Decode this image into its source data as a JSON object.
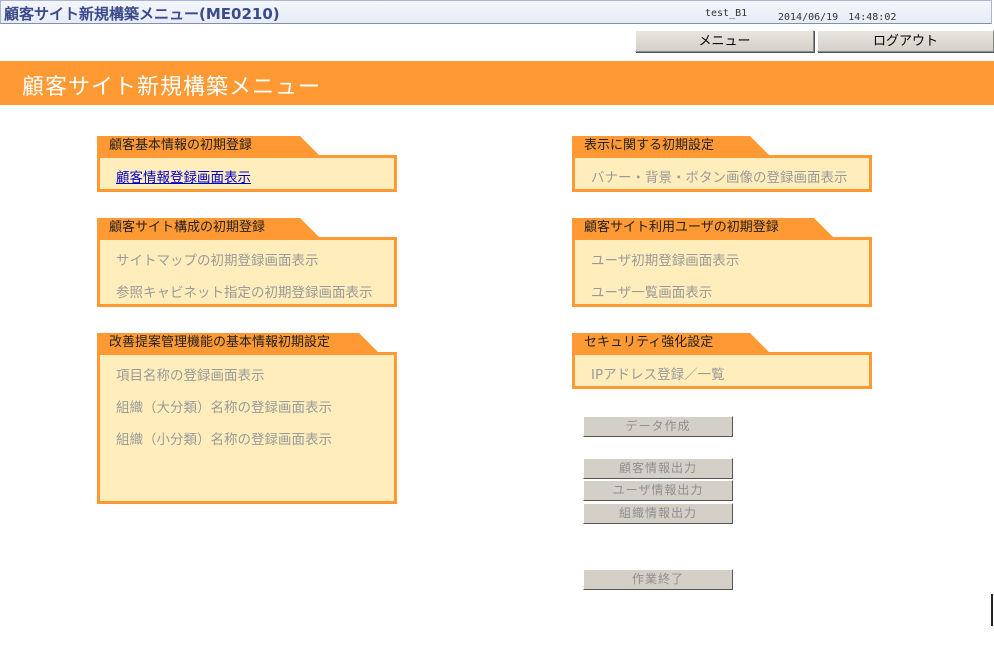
{
  "window": {
    "title": "顧客サイト新規構築メニュー(ME0210)",
    "user": "test_B1",
    "datetime": "2014/06/19　14:48:02"
  },
  "topnav": {
    "menu_label": "メニュー",
    "logout_label": "ログアウト"
  },
  "page_title": "顧客サイト新規構築メニュー",
  "sections": {
    "customer_basic": {
      "header": "顧客基本情報の初期登録",
      "items": [
        "顧客情報登録画面表示"
      ]
    },
    "display": {
      "header": "表示に関する初期設定",
      "items": [
        "バナー・背景・ボタン画像の登録画面表示"
      ]
    },
    "site_structure": {
      "header": "顧客サイト構成の初期登録",
      "items": [
        "サイトマップの初期登録画面表示",
        "参照キャビネット指定の初期登録画面表示"
      ]
    },
    "site_users": {
      "header": "顧客サイト利用ユーザの初期登録",
      "items": [
        "ユーザ初期登録画面表示",
        "ユーザ一覧画面表示"
      ]
    },
    "improvement": {
      "header": "改善提案管理機能の基本情報初期設定",
      "items": [
        "項目名称の登録画面表示",
        "組織（大分類）名称の登録画面表示",
        "組織（小分類）名称の登録画面表示"
      ]
    },
    "security": {
      "header": "セキュリティ強化設定",
      "items": [
        "IPアドレス登録／一覧"
      ]
    }
  },
  "actions": {
    "create_data": "データ作成",
    "export_customer": "顧客情報出力",
    "export_user": "ユーザ情報出力",
    "export_org": "組織情報出力",
    "finish": "作業終了"
  },
  "colors": {
    "accent": "#ff9933",
    "panel_bg": "#ffeebb",
    "link": "#0000cc",
    "disabled_text": "#9a9a9a"
  }
}
